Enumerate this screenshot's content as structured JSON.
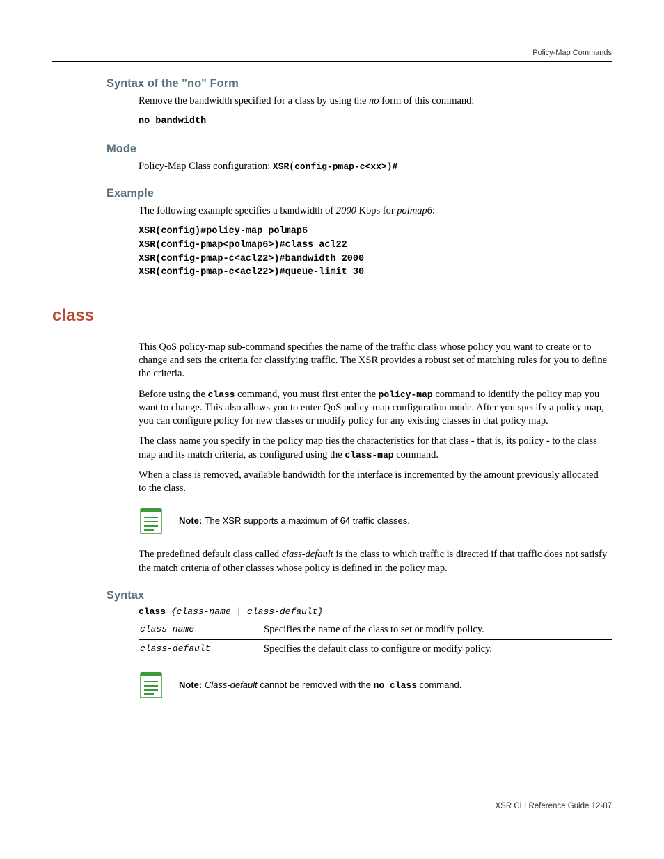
{
  "header": {
    "right": "Policy-Map Commands"
  },
  "s1": {
    "title": "Syntax of the \"no\" Form",
    "p1_a": "Remove the bandwidth specified for a class by using the ",
    "p1_em": "no",
    "p1_b": " form of this command:",
    "code": "no bandwidth"
  },
  "s2": {
    "title": "Mode",
    "p1_a": "Policy-Map Class configuration: ",
    "p1_code": "XSR(config-pmap-c<xx>)#"
  },
  "s3": {
    "title": "Example",
    "p1_a": "The following example specifies a bandwidth of ",
    "p1_em1": "2000",
    "p1_b": " Kbps for ",
    "p1_em2": "polmap6",
    "p1_c": ":",
    "code": "XSR(config)#policy-map polmap6\nXSR(config-pmap<polmap6>)#class acl22\nXSR(config-pmap-c<acl22>)#bandwidth 2000\nXSR(config-pmap-c<acl22>)#queue-limit 30"
  },
  "main": {
    "title": "class",
    "p1": "This QoS policy-map sub-command specifies the name of the traffic class whose policy you want to create or to change and sets the criteria for classifying traffic. The XSR provides a robust set of matching rules for you to define the criteria.",
    "p2_a": "Before using the ",
    "p2_c1": "class",
    "p2_b": " command, you must first enter the ",
    "p2_c2": "policy-map",
    "p2_c": " command to identify the policy map you want to change. This also allows you to enter QoS policy-map configuration mode. After you specify a policy map, you can configure policy for new classes or modify policy for any existing classes in that policy map.",
    "p3_a": "The class name you specify in the policy map ties the characteristics for that class - that is, its policy - to the class map and its match criteria, as configured using the ",
    "p3_c1": "class-map",
    "p3_b": " command.",
    "p4": "When a class is removed, available bandwidth for the interface is incremented by the amount previously allocated to the class.",
    "note1_label": "Note:",
    "note1_text": " The XSR supports a maximum of 64 traffic classes.",
    "p5_a": "The predefined default class called ",
    "p5_em": "class-default",
    "p5_b": " is the class to which traffic is directed if that traffic does not satisfy the match criteria of other classes whose policy is defined in the policy map."
  },
  "syntax": {
    "title": "Syntax",
    "line_b": "class",
    "line_i": " {class-name | class-default}",
    "rows": [
      {
        "term": "class-name",
        "desc": "Specifies the name of the class to set or modify policy."
      },
      {
        "term": "class-default",
        "desc": "Specifies the default class to configure or modify policy."
      }
    ],
    "note2_label": "Note:",
    "note2_em": " Class-default",
    "note2_mid": " cannot be removed with the ",
    "note2_code": "no class",
    "note2_end": " command."
  },
  "footer": {
    "text": "XSR CLI Reference Guide   12-87"
  }
}
